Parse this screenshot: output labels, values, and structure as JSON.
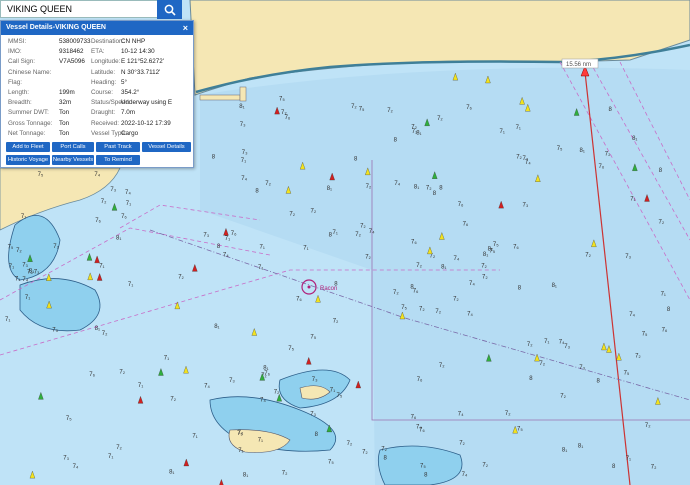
{
  "search": {
    "value": "VIKING QUEEN"
  },
  "panel": {
    "title": "Vessel Details-VIKING QUEEN",
    "close": "×",
    "left_fields": [
      {
        "label": "MMSI:",
        "value": "538009733"
      },
      {
        "label": "IMO:",
        "value": "9318462"
      },
      {
        "label": "Call Sign:",
        "value": "V7A5096"
      },
      {
        "label": "Chinese Name:",
        "value": ""
      },
      {
        "label": "Flag:",
        "value": ""
      },
      {
        "label": "Length:",
        "value": "199m"
      },
      {
        "label": "Breadth:",
        "value": "32m"
      },
      {
        "label": "Summer DWT:",
        "value": "Ton"
      },
      {
        "label": "Gross Tonnage:",
        "value": "Ton"
      },
      {
        "label": "Net Tonnage:",
        "value": "Ton"
      }
    ],
    "right_fields": [
      {
        "label": "Destination:",
        "value": "CN NHP"
      },
      {
        "label": "ETA:",
        "value": "10-12 14:30"
      },
      {
        "label": "Longitude:",
        "value": "E 121°52.6272'"
      },
      {
        "label": "Latitude:",
        "value": "N 30°33.7112'"
      },
      {
        "label": "Heading:",
        "value": "5°"
      },
      {
        "label": "Course:",
        "value": "354.2°"
      },
      {
        "label": "Status/Speed:",
        "value": "Underway using E"
      },
      {
        "label": "Draught:",
        "value": "7.0m"
      },
      {
        "label": "Received:",
        "value": "2022-10-12 17:39"
      },
      {
        "label": "Vessel Type:",
        "value": "Cargo"
      }
    ],
    "buttons": [
      "Add to Fleet",
      "Port Calls",
      "Past Track",
      "Vessel Details",
      "Historic Voyage",
      "Nearby Vessels",
      "To Remind"
    ]
  },
  "map": {
    "ship_label": "15.56 nm",
    "area_label": "Racon",
    "depth_labels": [
      "7₂",
      "8",
      "7₆",
      "7₂",
      "8₁",
      "7₅",
      "7₁",
      "8",
      "7₂",
      "7₄",
      "7₆",
      "7₂",
      "7₁",
      "8",
      "7₅",
      "7₃",
      "7₂",
      "8₁",
      "7₆",
      "7₂",
      "7₄",
      "7₁",
      "8",
      "7₂",
      "7₅",
      "7₃",
      "7₂",
      "8₁",
      "7₄",
      "7₂"
    ],
    "colors": {
      "water": "#bfe3f7",
      "land": "#f5e7b4",
      "shoal": "#8fd0ee",
      "route": "#cc3333",
      "zone": "#c86ec8"
    }
  }
}
